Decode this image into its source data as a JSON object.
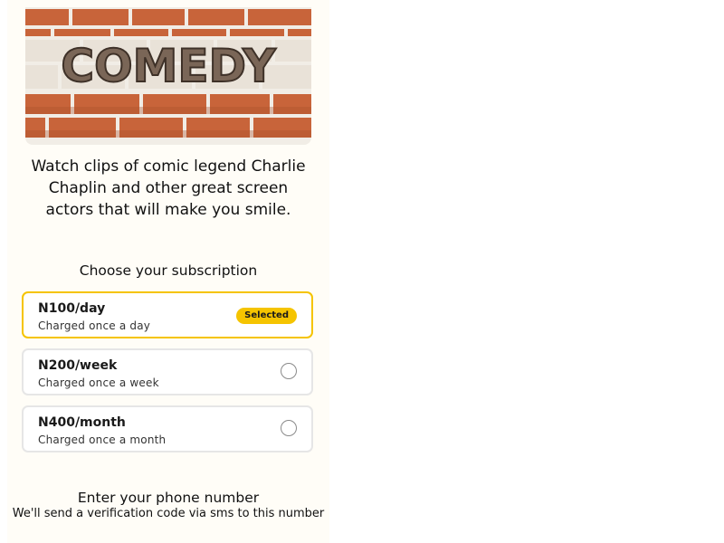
{
  "hero": {
    "image_word": "COMEDY",
    "brick_color": "#c8643a",
    "mortar_color": "#f1ede6"
  },
  "description": "Watch clips of comic legend Charlie Chaplin and other great screen actors that will make you smile.",
  "subscription": {
    "heading": "Choose your subscription",
    "selected_badge": "Selected",
    "accent_color": "#f5c400",
    "plans": [
      {
        "title": "N100/day",
        "subtitle": "Charged once a day",
        "selected": true
      },
      {
        "title": "N200/week",
        "subtitle": "Charged once a week",
        "selected": false
      },
      {
        "title": "N400/month",
        "subtitle": "Charged once a month",
        "selected": false
      }
    ]
  },
  "phone": {
    "heading": "Enter your phone number",
    "subtext": "We'll send a verification code via sms to this number"
  }
}
